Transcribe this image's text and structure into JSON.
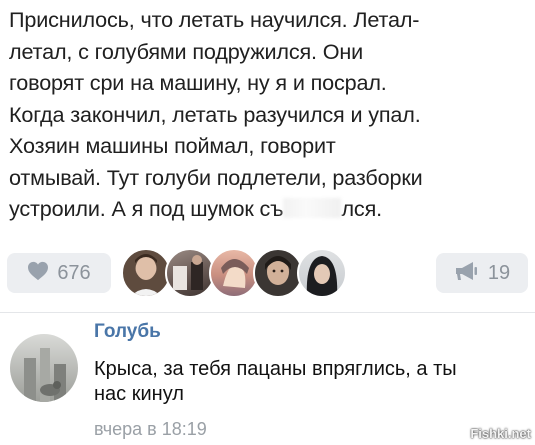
{
  "post": {
    "lines": [
      "Приснилось, что летать научился. Летал-",
      "летал, с голубями подружился. Они",
      "говорят сри на машину, ну я и посрал.",
      "Когда закончил, летать разучился и упал.",
      "Хозяин машины поймал, говорит",
      "отмывай. Тут голуби подлетели, разборки"
    ],
    "last_line_start": "устроили. А я под шумок съ",
    "last_line_end": "лся."
  },
  "actions": {
    "like_icon": "heart-icon",
    "like_count": "676",
    "share_icon": "megaphone-icon",
    "share_count": "19",
    "liker_avatars": [
      {
        "name": "avatar-1",
        "color": "#5e4b3e"
      },
      {
        "name": "avatar-2",
        "color": "#7a6a64"
      },
      {
        "name": "avatar-3",
        "color": "#c99a8c"
      },
      {
        "name": "avatar-4",
        "color": "#3b3633"
      },
      {
        "name": "avatar-5",
        "color": "#2a2c30"
      }
    ]
  },
  "comment": {
    "author": "Голубь",
    "text_line1": "Крыса, за тебя пацаны впряглись, а ты",
    "text_line2": "нас кинул",
    "time": "вчера в 18:19"
  },
  "colors": {
    "link": "#4a76a8",
    "muted": "#8c939b",
    "button_bg": "#eceef1"
  },
  "watermark": "Fishki.net"
}
